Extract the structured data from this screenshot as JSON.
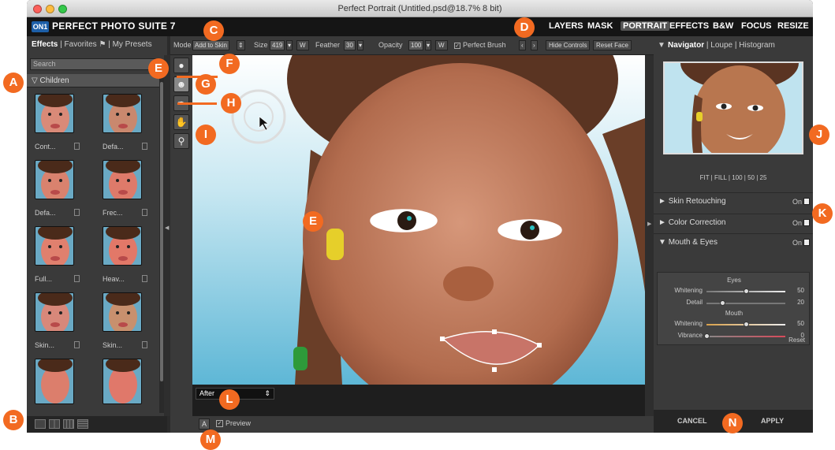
{
  "window": {
    "title": "Perfect Portrait (Untitled.psd@18.7% 8 bit)"
  },
  "app": {
    "logo": "ON1",
    "brand": "PERFECT PHOTO SUITE 7"
  },
  "module_tabs": [
    {
      "label": "LAYERS",
      "active": false
    },
    {
      "label": "MASK",
      "active": false
    },
    {
      "label": "PORTRAIT",
      "active": true
    },
    {
      "label": "EFFECTS",
      "active": false
    },
    {
      "label": "B&W",
      "active": false
    },
    {
      "label": "FOCUS",
      "active": false
    },
    {
      "label": "RESIZE",
      "active": false
    }
  ],
  "left_panel": {
    "tabs": [
      "Effects",
      "Favorites",
      "My Presets"
    ],
    "search_placeholder": "Search",
    "category": "Children",
    "presets": [
      "Cont...",
      "Defa...",
      "Defa...",
      "Frec...",
      "Full...",
      "Heav...",
      "Skin...",
      "Skin..."
    ]
  },
  "tool_options": {
    "mode_label": "Mode",
    "mode_value": "Add to Skin",
    "size_label": "Size",
    "size_value": "419",
    "feather_label": "Feather",
    "feather_value": "30",
    "opacity_label": "Opacity",
    "opacity_value": "100",
    "w_label": "W",
    "perfect_brush_label": "Perfect Brush",
    "hide_controls_label": "Hide Controls",
    "reset_face_label": "Reset Face"
  },
  "view_bar": {
    "view_mode": "After",
    "compare_button": "A",
    "preview_label": "Preview"
  },
  "right_panel": {
    "tabs": [
      "Navigator",
      "Loupe",
      "Histogram"
    ],
    "zoom_options": "FIT | FILL | 100 | 50 | 25",
    "sections": [
      {
        "title": "Skin Retouching",
        "state": "On"
      },
      {
        "title": "Color Correction",
        "state": "On"
      },
      {
        "title": "Mouth & Eyes",
        "state": "On"
      }
    ],
    "eyes_header": "Eyes",
    "mouth_header": "Mouth",
    "sliders": [
      {
        "label": "Whitening",
        "value": "50",
        "pos": 0.5
      },
      {
        "label": "Detail",
        "value": "20",
        "pos": 0.2
      },
      {
        "label": "Whitening",
        "value": "50",
        "pos": 0.5
      },
      {
        "label": "Vibrance",
        "value": "0",
        "pos": 0.0
      }
    ],
    "reset_label": "Reset",
    "cancel_label": "CANCEL",
    "apply_label": "APPLY"
  },
  "callouts": [
    "A",
    "B",
    "C",
    "D",
    "E",
    "E",
    "F",
    "G",
    "H",
    "I",
    "J",
    "K",
    "L",
    "M",
    "N"
  ],
  "colors": {
    "callout": "#f26a21",
    "accent": "#1d5fa8"
  }
}
